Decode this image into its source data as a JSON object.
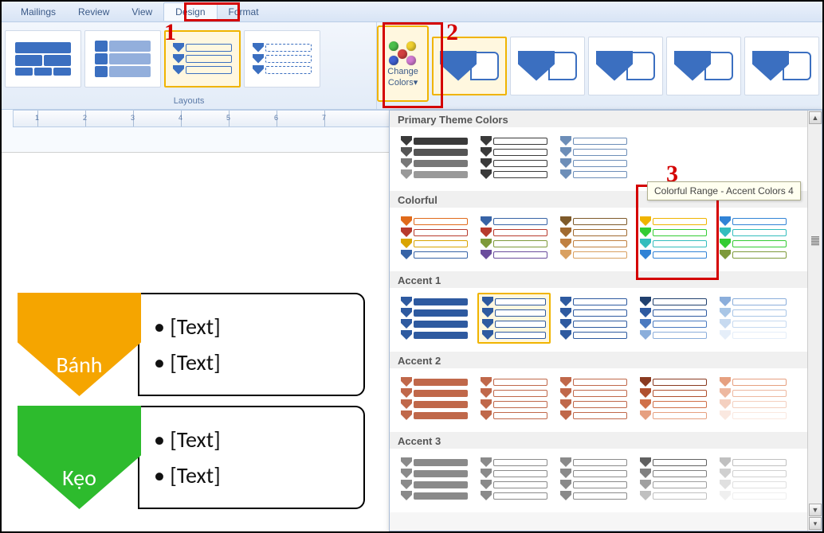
{
  "tabs": [
    "Mailings",
    "Review",
    "View",
    "Design",
    "Format"
  ],
  "active_tab": "Design",
  "group_layouts_label": "Layouts",
  "change_colors": {
    "line1": "Change",
    "line2": "Colors▾"
  },
  "annotations": {
    "a1": "1",
    "a2": "2",
    "a3": "3"
  },
  "smartart": {
    "rows": [
      {
        "label": "Bánh",
        "color": "#f5a500",
        "bullets": [
          "• [Text]",
          "• [Text]"
        ]
      },
      {
        "label": "Kẹo",
        "color": "#2dbb2d",
        "bullets": [
          "• [Text]",
          "• [Text]"
        ]
      }
    ]
  },
  "panel": {
    "categories": [
      "Primary Theme Colors",
      "Colorful",
      "Accent 1",
      "Accent 2",
      "Accent 3"
    ],
    "tooltip": "Colorful Range - Accent Colors 4",
    "swatches": {
      "primary": [
        [
          "#3a3a3a",
          "#555",
          "#777",
          "#999"
        ],
        [
          "#3a3a3a",
          "#3a3a3a",
          "#3a3a3a",
          "#3a3a3a"
        ],
        [
          "#6d8eb8",
          "#6d8eb8",
          "#6d8eb8",
          "#6d8eb8"
        ]
      ],
      "colorful": [
        [
          "#e06a1a",
          "#b73a2d",
          "#d9a400",
          "#3763a6"
        ],
        [
          "#3763a6",
          "#b73a2d",
          "#7e9a3a",
          "#6a4c9c"
        ],
        [
          "#7e5a2a",
          "#a06a30",
          "#c08040",
          "#d9a060"
        ],
        [
          "#f0b400",
          "#33cc33",
          "#33bdbd",
          "#3183d6"
        ],
        [
          "#3183d6",
          "#33bdbd",
          "#33cc33",
          "#7e9a3a"
        ]
      ],
      "accent1": [
        [
          "#2e5aa0",
          "#2e5aa0",
          "#2e5aa0",
          "#2e5aa0"
        ],
        [
          "#2e5aa0",
          "#2e5aa0",
          "#2e5aa0",
          "#2e5aa0"
        ],
        [
          "#2e5aa0",
          "#2e5aa0",
          "#2e5aa0",
          "#2e5aa0"
        ],
        [
          "#20406e",
          "#2e5aa0",
          "#4a7ac0",
          "#8baedb"
        ],
        [
          "#8baedb",
          "#a9c6e6",
          "#c7daf0",
          "#e5eef9"
        ]
      ],
      "accent2": [
        [
          "#c0684a",
          "#c0684a",
          "#c0684a",
          "#c0684a"
        ],
        [
          "#c0684a",
          "#c0684a",
          "#c0684a",
          "#c0684a"
        ],
        [
          "#c0684a",
          "#c0684a",
          "#c0684a",
          "#c0684a"
        ],
        [
          "#8a3a20",
          "#b0502e",
          "#d07048",
          "#e6a080"
        ],
        [
          "#e6a080",
          "#edb8a0",
          "#f4d0c0",
          "#fae8e0"
        ]
      ],
      "accent3": [
        [
          "#8a8a8a",
          "#8a8a8a",
          "#8a8a8a",
          "#8a8a8a"
        ],
        [
          "#8a8a8a",
          "#8a8a8a",
          "#8a8a8a",
          "#8a8a8a"
        ],
        [
          "#8a8a8a",
          "#8a8a8a",
          "#8a8a8a",
          "#8a8a8a"
        ],
        [
          "#606060",
          "#808080",
          "#a0a0a0",
          "#c0c0c0"
        ],
        [
          "#c0c0c0",
          "#d0d0d0",
          "#e0e0e0",
          "#efefef"
        ]
      ]
    }
  },
  "ruler_numbers": [
    1,
    2,
    3,
    4,
    5,
    6,
    7
  ]
}
